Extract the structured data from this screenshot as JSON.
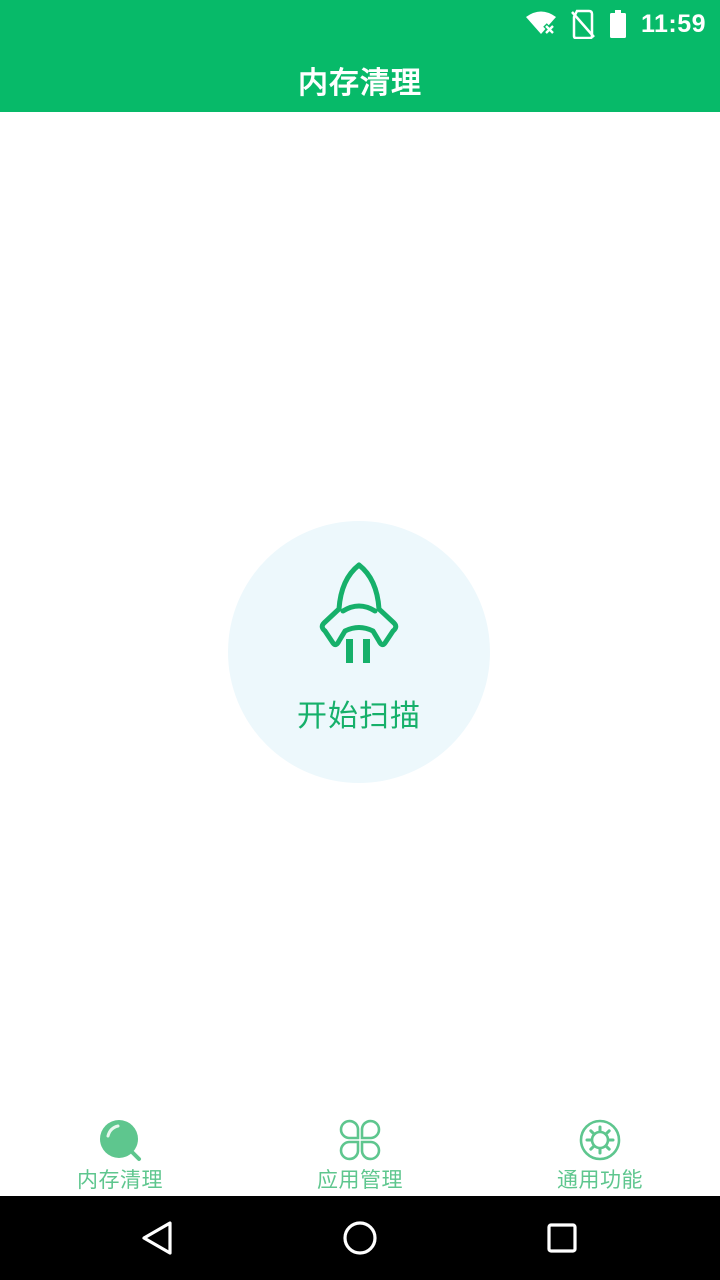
{
  "status_bar": {
    "time": "11:59",
    "icons": [
      "wifi-off-icon",
      "no-sim-icon",
      "battery-icon"
    ]
  },
  "app_bar": {
    "title": "内存清理"
  },
  "scan": {
    "icon": "rocket-icon",
    "label": "开始扫描"
  },
  "tabs": [
    {
      "label": "内存清理",
      "icon": "memory-clean-icon",
      "active": true
    },
    {
      "label": "应用管理",
      "icon": "app-grid-icon",
      "active": false
    },
    {
      "label": "通用功能",
      "icon": "gear-icon",
      "active": false
    }
  ],
  "nav_bar": {
    "icons": [
      "back-icon",
      "home-icon",
      "recents-icon"
    ]
  },
  "colors": {
    "primary": "#07BA69",
    "scan_circle": "#EDF8FC",
    "accent_text": "#16B06A",
    "tab_label": "#5EC68E",
    "nav_bar": "#000000"
  }
}
